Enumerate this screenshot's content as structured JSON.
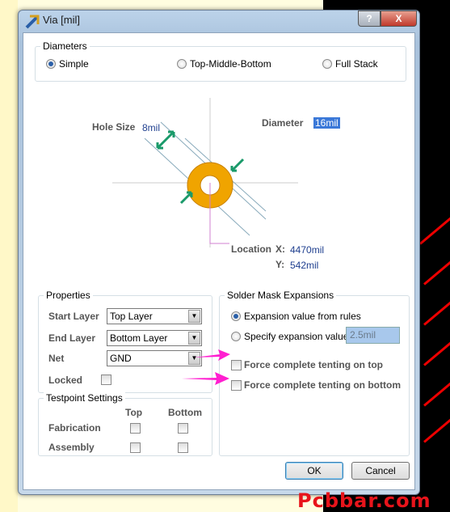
{
  "window": {
    "title": "Via [mil]",
    "help": "?",
    "close": "X"
  },
  "diameters": {
    "title": "Diameters",
    "options": [
      {
        "label": "Simple",
        "selected": true
      },
      {
        "label": "Top-Middle-Bottom",
        "selected": false
      },
      {
        "label": "Full Stack",
        "selected": false
      }
    ]
  },
  "diagram": {
    "hole_size_label": "Hole Size",
    "hole_size_value": "8mil",
    "diameter_label": "Diameter",
    "diameter_value": "16mil",
    "location_label": "Location",
    "x_label": "X:",
    "x_value": "4470mil",
    "y_label": "Y:",
    "y_value": "542mil",
    "pad_color": "#f0a400"
  },
  "properties": {
    "title": "Properties",
    "start_layer_label": "Start Layer",
    "start_layer": "Top Layer",
    "end_layer_label": "End Layer",
    "end_layer": "Bottom Layer",
    "net_label": "Net",
    "net": "GND",
    "locked_label": "Locked",
    "locked": false
  },
  "testpoint": {
    "title": "Testpoint Settings",
    "col_top": "Top",
    "col_bottom": "Bottom",
    "fabrication_label": "Fabrication",
    "assembly_label": "Assembly"
  },
  "solder_mask": {
    "title": "Solder Mask Expansions",
    "from_rules_label": "Expansion value from rules",
    "from_rules_selected": true,
    "specify_label": "Specify expansion value",
    "specify_value": "2.5mil",
    "tent_top_label": "Force complete tenting on top",
    "tent_bottom_label": "Force complete tenting on bottom"
  },
  "buttons": {
    "ok": "OK",
    "cancel": "Cancel"
  },
  "watermark": "Pcbbar.com",
  "annotation_arrow_color": "#ff1fd0"
}
